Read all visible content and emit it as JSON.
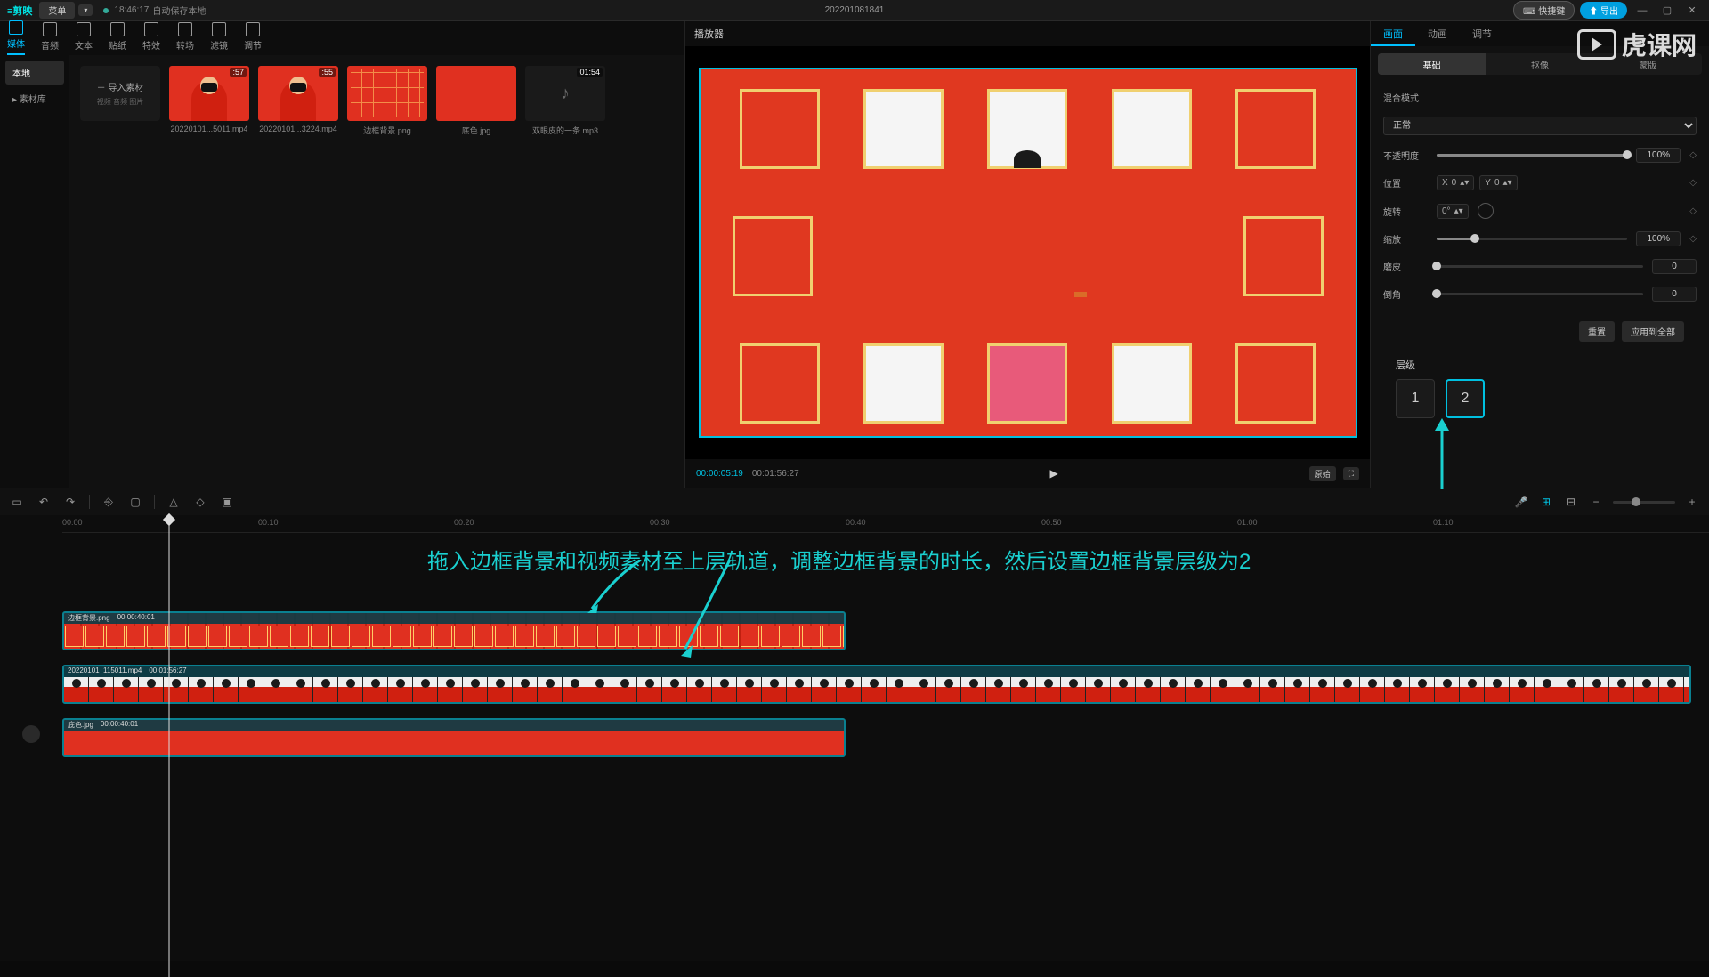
{
  "titlebar": {
    "logo": "≡剪映",
    "menu": "菜单",
    "status_time": "18:46:17",
    "status_text": "自动保存本地",
    "doc_title": "202201081841",
    "shortcut_btn": "⌨ 快捷键",
    "export_btn": "⬆ 导出"
  },
  "tabs": [
    {
      "label": "媒体",
      "active": true
    },
    {
      "label": "音频"
    },
    {
      "label": "文本"
    },
    {
      "label": "贴纸"
    },
    {
      "label": "特效"
    },
    {
      "label": "转场"
    },
    {
      "label": "滤镜"
    },
    {
      "label": "调节"
    }
  ],
  "media_sidebar": [
    {
      "label": "本地",
      "active": true
    },
    {
      "label": "▸ 素材库"
    }
  ],
  "import_tile": {
    "label": "导入素材",
    "sub": "视频  音频  图片"
  },
  "clips": [
    {
      "name": "20220101...5011.mp4",
      "dur": ":57",
      "type": "person"
    },
    {
      "name": "20220101...3224.mp4",
      "dur": ":55",
      "type": "person"
    },
    {
      "name": "边框背景.png",
      "dur": "",
      "type": "grid"
    },
    {
      "name": "底色.jpg",
      "dur": "",
      "type": "solid"
    },
    {
      "name": "双眼皮的一条.mp3",
      "dur": "01:54",
      "type": "audio"
    }
  ],
  "preview": {
    "title": "播放器",
    "time_current": "00:00:05:19",
    "time_total": "00:01:56:27",
    "ratio_btn": "原始"
  },
  "props": {
    "tabs": [
      {
        "label": "画面",
        "active": true
      },
      {
        "label": "动画"
      },
      {
        "label": "调节"
      }
    ],
    "subtabs": [
      {
        "label": "基础",
        "active": true
      },
      {
        "label": "抠像"
      },
      {
        "label": "蒙版"
      }
    ],
    "blend_label": "混合模式",
    "blend_value": "正常",
    "opacity_label": "不透明度",
    "opacity_value": "100%",
    "position_label": "位置",
    "pos_x_label": "X",
    "pos_x": "0",
    "pos_y_label": "Y",
    "pos_y": "0",
    "rotation_label": "旋转",
    "rotation_value": "0°",
    "scale_label": "缩放",
    "scale_value": "100%",
    "skew_label": "磨皮",
    "skew_value": "0",
    "round_label": "倒角",
    "round_value": "0",
    "btn_reset": "重置",
    "btn_apply_all": "应用到全部",
    "layer_label": "层级",
    "layer_1": "1",
    "layer_2": "2"
  },
  "timeline": {
    "ticks": [
      "00:00",
      "00:10",
      "00:20",
      "00:30",
      "00:40",
      "00:50",
      "01:00",
      "01:10"
    ],
    "track1": {
      "name": "边框背景.png",
      "dur": "00:00:40:01"
    },
    "track2": {
      "name": "20220101_115011.mp4",
      "dur": "00:01:56:27"
    },
    "track3": {
      "name": "底色.jpg",
      "dur": "00:00:40:01"
    }
  },
  "annotation": "拖入边框背景和视频素材至上层轨道，调整边框背景的时长，然后设置边框背景层级为2",
  "watermark": "虎课网"
}
